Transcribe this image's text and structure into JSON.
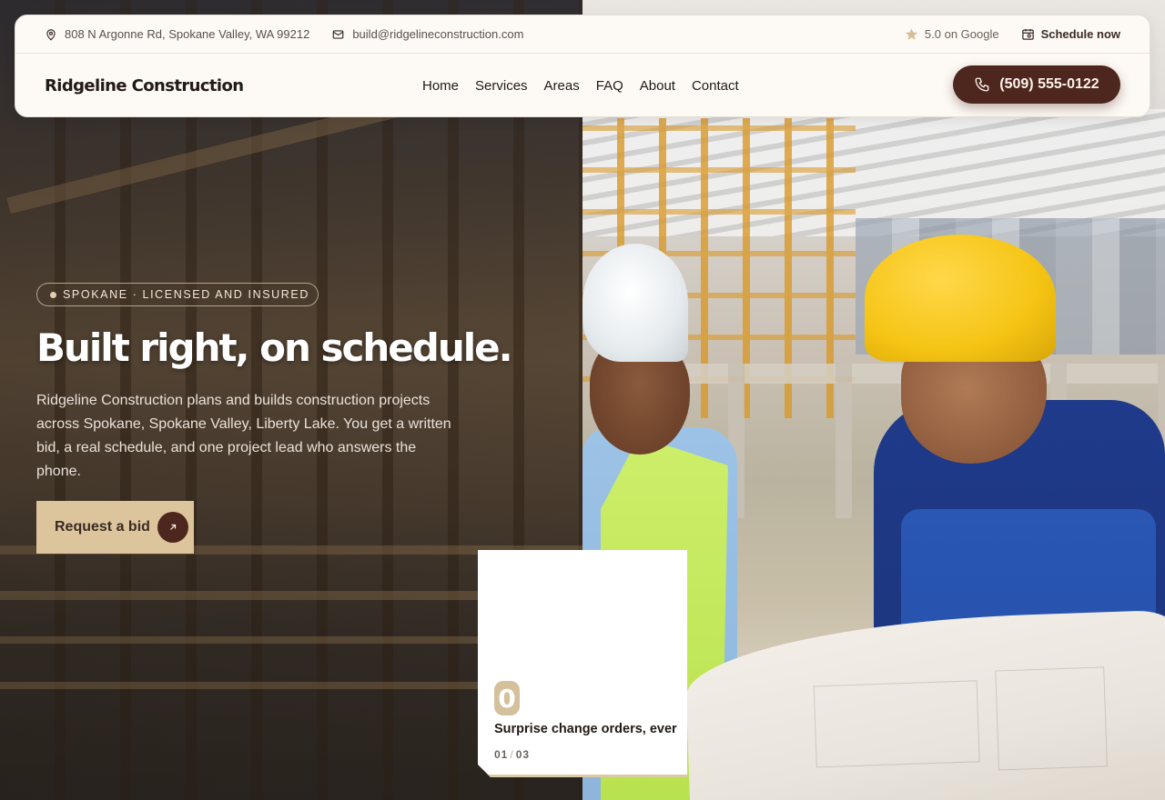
{
  "topbar": {
    "address": "808 N Argonne Rd, Spokane Valley, WA 99212",
    "email": "build@ridgelineconstruction.com",
    "rating": "5.0 on Google",
    "schedule": "Schedule now"
  },
  "header": {
    "brand": "Ridgeline Construction",
    "nav": [
      "Home",
      "Services",
      "Areas",
      "FAQ",
      "About",
      "Contact"
    ],
    "phone": "(509) 555-0122"
  },
  "hero": {
    "badge": "SPOKANE · LICENSED AND INSURED",
    "headline": "Built right, on schedule.",
    "lede": "Ridgeline Construction plans and builds construction projects across Spokane, Spokane Valley, Liberty Lake. You get a written bid, a real schedule, and one project lead who answers the phone.",
    "cta": "Request a bid"
  },
  "stat": {
    "number": "0",
    "label": "Surprise change orders, ever",
    "current": "01",
    "total": "03"
  },
  "colors": {
    "accent": "#4d261d",
    "sand": "#dcc49c",
    "header_bg": "#fdf9f5"
  },
  "icons": [
    "map-pin-icon",
    "mail-icon",
    "star-icon",
    "calendar-icon",
    "phone-icon",
    "arrow-up-right-icon"
  ]
}
